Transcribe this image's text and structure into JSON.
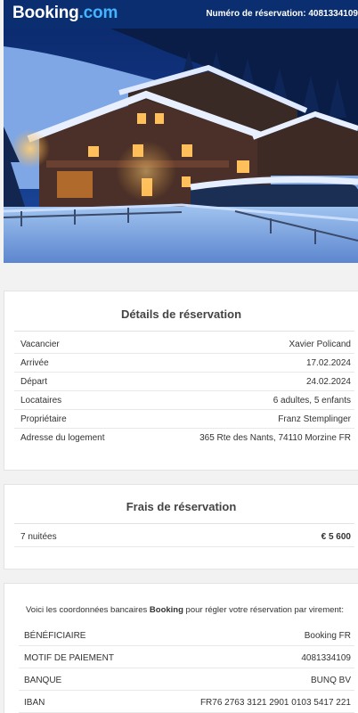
{
  "header": {
    "brand_main": "Booking",
    "brand_suffix": ".com",
    "reservation_label": "Numéro de réservation:",
    "reservation_number": "4081334109"
  },
  "hero": {
    "alt": "chalet-in-snow-night-photo"
  },
  "details": {
    "title": "Détails de réservation",
    "rows": [
      {
        "label": "Vacancier",
        "value": "Xavier Policand"
      },
      {
        "label": "Arrivée",
        "value": "17.02.2024"
      },
      {
        "label": "Départ",
        "value": "24.02.2024"
      },
      {
        "label": "Locataires",
        "value": "6 adultes, 5 enfants"
      },
      {
        "label": "Propriétaire",
        "value": "Franz Stemplinger"
      },
      {
        "label": "Adresse du logement",
        "value": "365 Rte des Nants, 74110 Morzine FR"
      }
    ]
  },
  "fees": {
    "title": "Frais de réservation",
    "nights_label": "7  nuitées",
    "total": "€ 5 600"
  },
  "bank": {
    "intro_before": "Voici les coordonnées bancaires ",
    "intro_brand": "Booking",
    "intro_after": " pour régler votre réservation par virement:",
    "rows": [
      {
        "label": "BÉNÉFICIAIRE",
        "value": "Booking FR"
      },
      {
        "label": "MOTIF DE PAIEMENT",
        "value": "4081334109"
      },
      {
        "label": "BANQUE",
        "value": "BUNQ BV"
      },
      {
        "label": "IBAN",
        "value": "FR76 2763 3121 2901 0103 5417 221"
      }
    ]
  },
  "colors": {
    "header_bg": "#0a2e6f",
    "brand_dot": "#44b4ff"
  }
}
